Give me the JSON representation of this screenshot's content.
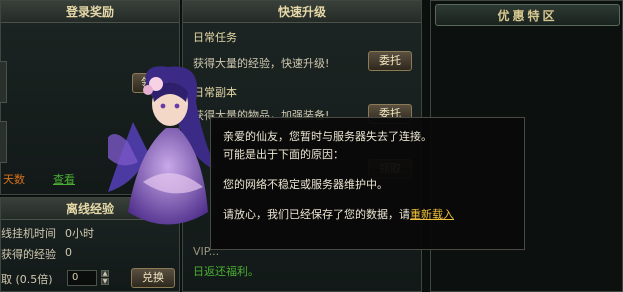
{
  "login_reward": {
    "title": "登录奖励",
    "claim_button": "领取",
    "days_label": "天数",
    "view_link": "查看"
  },
  "offline_exp": {
    "title": "离线经验",
    "hang_time_label": "线挂机时间",
    "hang_time_value": "0小时",
    "gained_exp_label": "获得的经验",
    "gained_exp_value": "0",
    "multiplier_label": "取 (0.5倍)",
    "multiplier_value": "0",
    "exchange_button": "兑换"
  },
  "quick_level": {
    "title": "快速升级",
    "daily_task_title": "日常任务",
    "daily_task_desc": "获得大量的经验，快速升级!",
    "daily_task_button": "委托",
    "daily_dungeon_title": "日常副本",
    "daily_dungeon_desc": "获得大量的物品，加强装备!",
    "daily_dungeon_button": "委托",
    "third_button": "领取",
    "vip_text": "VIP...",
    "vip_link": "日返还福利。"
  },
  "special_offer": {
    "title": "优惠特区"
  },
  "dialog": {
    "line1": "亲爱的仙友，您暂时与服务器失去了连接。",
    "line2": "可能是出于下面的原因：",
    "line3": "您的网络不稳定或服务器维护中。",
    "line4_prefix": "请放心，我们已经保存了您的数据，请",
    "reload_link": "重新载入"
  },
  "colors": {
    "gold": "#e6d9a8",
    "green": "#4caf34",
    "orange": "#d8721a",
    "link": "#f2c23a"
  }
}
